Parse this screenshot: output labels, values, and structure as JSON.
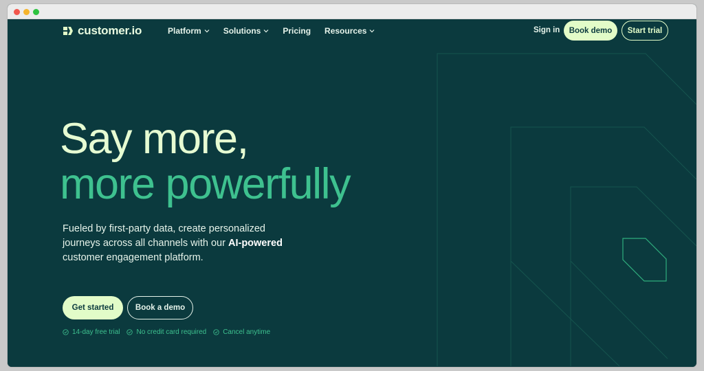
{
  "brand": {
    "name": "customer.io",
    "colors": {
      "background": "#0b3a3e",
      "accent_light": "#e2fcc8",
      "accent_green": "#3ec18f",
      "text": "#e6f3ea"
    }
  },
  "nav": {
    "items": [
      {
        "label": "Platform",
        "has_dropdown": true
      },
      {
        "label": "Solutions",
        "has_dropdown": true
      },
      {
        "label": "Pricing",
        "has_dropdown": false
      },
      {
        "label": "Resources",
        "has_dropdown": true
      }
    ],
    "sign_in": "Sign in",
    "book_demo": "Book demo",
    "start_trial": "Start trial"
  },
  "hero": {
    "title_line1": "Say more,",
    "title_line2": "more powerfully",
    "subtitle_before": "Fueled by first-party data, create personalized journeys across all channels with our ",
    "subtitle_bold": "AI-powered",
    "subtitle_after": " customer engagement platform.",
    "cta_primary": "Get started",
    "cta_secondary": "Book a demo",
    "perks": [
      "14-day free trial",
      "No credit card required",
      "Cancel anytime"
    ]
  },
  "icons": {
    "logo": "logo-mark-icon",
    "dropdown": "chevron-down-icon",
    "perk": "check-circle-icon"
  }
}
